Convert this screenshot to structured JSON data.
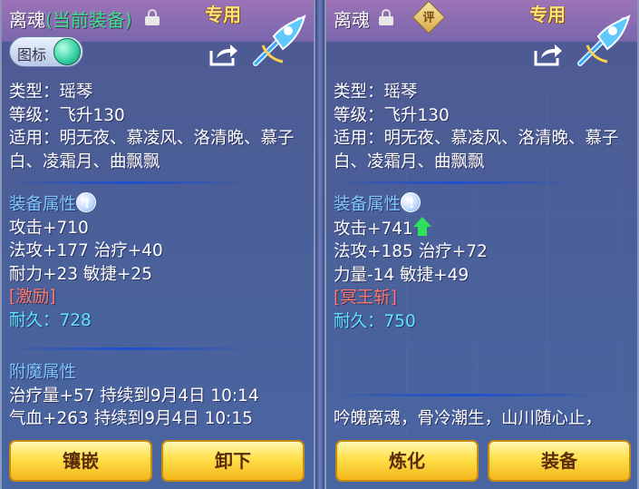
{
  "left": {
    "title": "离魂",
    "title_suffix": "(当前装备)",
    "exclusive": "专用",
    "icon_toggle_label": "图标",
    "type": "类型：瑶琴",
    "level": "等级：飞升130",
    "applicable": "适用：明无夜、慕凌风、洛清晚、慕子白、凌霜月、曲飘飘",
    "attr_head": "装备属性",
    "attr1": "攻击+710",
    "attr2": "法攻+177 治疗+40",
    "attr3": "耐力+23 敏捷+25",
    "special": "[激励]",
    "durability": "耐久：728",
    "enchant_head": "附魔属性",
    "enchant1": "治疗量+57 持续到9月4日 10:14",
    "enchant2": "气血+263 持续到9月4日 10:15",
    "buttons": [
      "镶嵌",
      "卸下"
    ]
  },
  "right": {
    "title": "离魂",
    "rate_label": "评",
    "exclusive": "专用",
    "type": "类型：瑶琴",
    "level": "等级：飞升130",
    "applicable": "适用：明无夜、慕凌风、洛清晚、慕子白、凌霜月、曲飘飘",
    "attr_head": "装备属性",
    "attr1": "攻击+741",
    "attr2": "法攻+185 治疗+72",
    "attr3": "力量-14 敏捷+49",
    "special": "[冥王斩]",
    "durability": "耐久：750",
    "flavor": "吟魄离魂，骨冷潮生，山川随心止，",
    "buttons": [
      "炼化",
      "装备"
    ]
  },
  "icons": {
    "lock": "lock-open-icon",
    "share": "share-icon",
    "weapon": "zither-weapon-icon",
    "info": "info-icon",
    "up": "up-arrow-icon",
    "rate": "rate-icon"
  },
  "colors": {
    "exclusive": "#ffe27a",
    "section": "#7ec9ff",
    "special": "#ff7a6a",
    "durability": "#5fe6ff",
    "current": "#3fe08a",
    "button": "#ffe04a"
  }
}
